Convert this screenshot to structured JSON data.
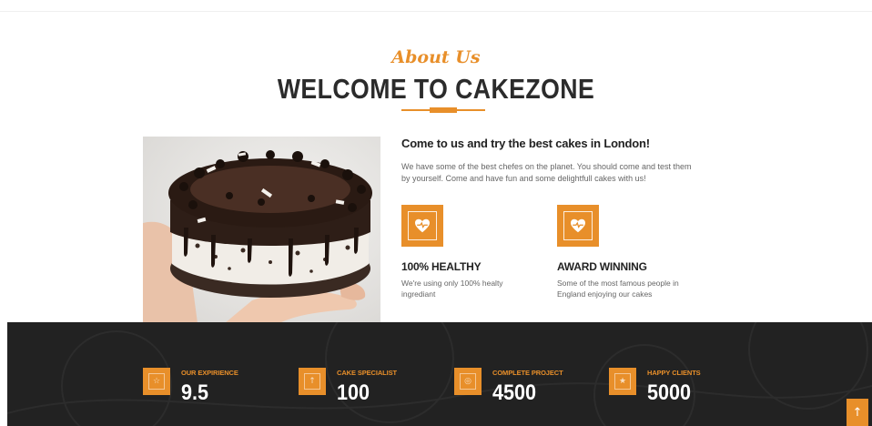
{
  "about": {
    "subtitle": "About Us",
    "title": "WELCOME TO CAKEZONE",
    "intro_heading": "Come to us and try the best cakes in London!",
    "intro_text": "We have some of the best chefes on the planet. You should come and test them by yourself. Come and have fun and some delightfull cakes with us!",
    "features": [
      {
        "icon": "heart-pulse-icon",
        "title": "100% HEALTHY",
        "text": "We're using only 100% healty ingrediant"
      },
      {
        "icon": "heart-pulse-icon",
        "title": "AWARD WINNING",
        "text": "Some of the most famous people in England enjoying our cakes"
      }
    ]
  },
  "stats": [
    {
      "icon": "star-icon",
      "label": "OUR EXPIRIENCE",
      "value": "9.5"
    },
    {
      "icon": "arrow-up-icon",
      "label": "CAKE SPECIALIST",
      "value": "100"
    },
    {
      "icon": "target-icon",
      "label": "COMPLETE PROJECT",
      "value": "4500"
    },
    {
      "icon": "star-icon",
      "label": "HAPPY CLIENTS",
      "value": "5000"
    }
  ],
  "back_to_top": {
    "icon": "arrow-up-icon",
    "glyph": "↑"
  },
  "colors": {
    "accent": "#e88f2a",
    "dark_band": "#222222",
    "heading": "#2b2b2b"
  }
}
